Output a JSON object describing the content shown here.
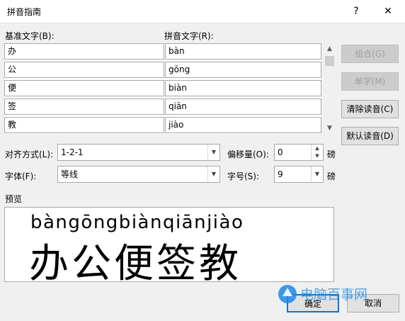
{
  "window": {
    "title": "拼音指南",
    "help_label": "?",
    "close_label": "✕"
  },
  "labels": {
    "base_text": "基准文字(B):",
    "ruby_text": "拼音文字(R):",
    "alignment": "对齐方式(L):",
    "offset": "偏移量(O):",
    "font": "字体(F):",
    "size": "字号(S):",
    "preview": "预览",
    "offset_unit": "磅",
    "size_unit": "磅"
  },
  "rows": [
    {
      "base": "办",
      "ruby": "bàn"
    },
    {
      "base": "公",
      "ruby": "gōng"
    },
    {
      "base": "便",
      "ruby": "biàn"
    },
    {
      "base": "签",
      "ruby": "qiān"
    },
    {
      "base": "教",
      "ruby": "jiào"
    }
  ],
  "buttons": {
    "group": "组合(G)",
    "mono": "单字(M)",
    "clear": "清除读音(C)",
    "default": "默认读音(D)",
    "ok": "确定",
    "cancel": "取消"
  },
  "fields": {
    "alignment": "1-2-1",
    "offset": "0",
    "font": "等线",
    "size": "9"
  },
  "preview": {
    "pinyin": "bàngōngbiànqiānjiào",
    "text": "办公便签教"
  },
  "watermark": "电脑百事网",
  "icons": {
    "scroll_up": "chevron-up-icon",
    "scroll_down": "chevron-down-icon",
    "dropdown": "chevron-down-icon",
    "spin_up": "triangle-up-icon",
    "spin_down": "triangle-down-icon"
  }
}
